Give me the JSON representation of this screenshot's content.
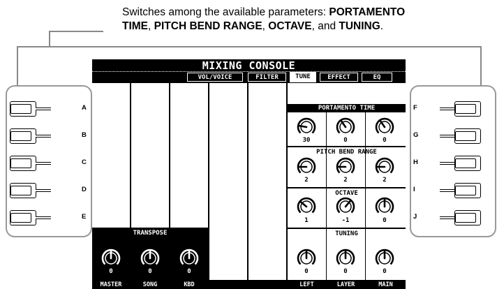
{
  "caption": {
    "line1": "Switches among the available parameters: ",
    "line1_bold": "PORTAMENTO",
    "line2_bold_a": "TIME",
    "sep1": ", ",
    "line2_bold_b": "PITCH BEND RANGE",
    "sep2": ", ",
    "line2_bold_c": "OCTAVE",
    "sep3": ", and ",
    "line2_bold_d": "TUNING",
    "end": "."
  },
  "left_buttons": [
    "A",
    "B",
    "C",
    "D",
    "E"
  ],
  "right_buttons": [
    "F",
    "G",
    "H",
    "I",
    "J"
  ],
  "screen": {
    "title": "MIXING CONSOLE",
    "tabs": [
      {
        "label": "VOL/VOICE",
        "active": false
      },
      {
        "label": "FILTER",
        "active": false
      },
      {
        "label": "TUNE",
        "active": true
      },
      {
        "label": "EFFECT",
        "active": false
      },
      {
        "label": "EQ",
        "active": false
      }
    ],
    "portamento": {
      "title": "PORTAMENTO TIME",
      "values": [
        "30",
        "0",
        "0"
      ]
    },
    "pitch_bend": {
      "title": "PITCH BEND RANGE",
      "values": [
        "2",
        "2",
        "2"
      ]
    },
    "octave": {
      "title": "OCTAVE",
      "values": [
        "1",
        "-1",
        "0"
      ]
    },
    "tuning": {
      "title": "TUNING",
      "values": [
        "0",
        "0",
        "0"
      ]
    },
    "transpose": {
      "title": "TRANSPOSE",
      "values": [
        "0",
        "0",
        "0"
      ]
    },
    "bottom_labels": [
      "MASTER",
      "SONG",
      "KBD",
      "",
      "",
      "LEFT",
      "LAYER",
      "MAIN"
    ]
  },
  "colors": {
    "screen_bg": "#000000",
    "panel_bg": "#ffffff",
    "callout_line": "#888888"
  }
}
